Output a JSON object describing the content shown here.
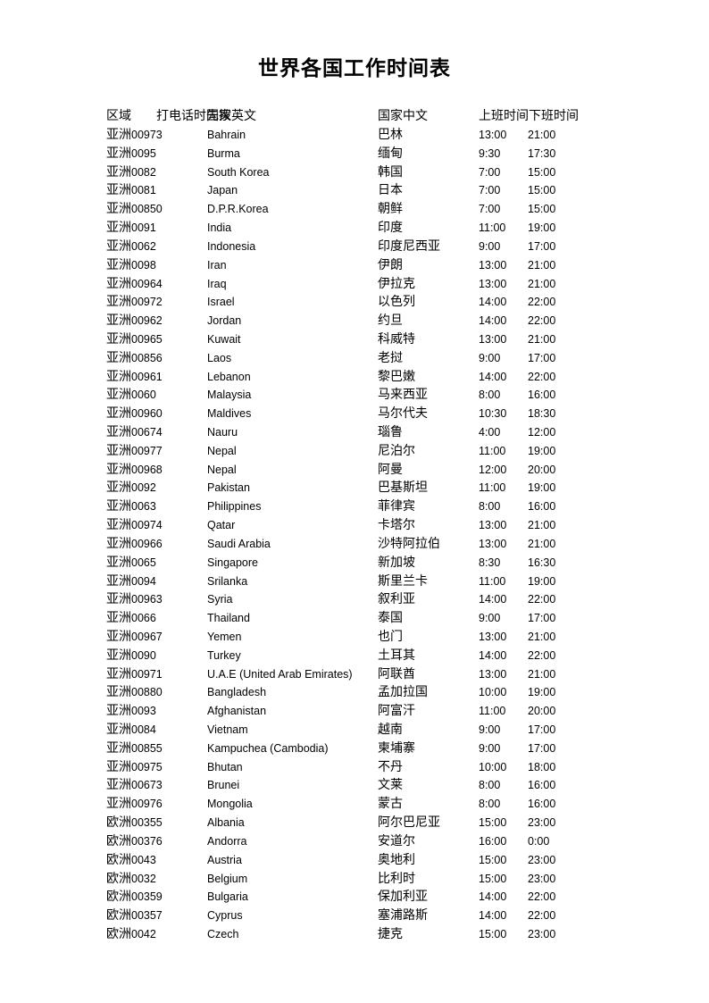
{
  "title": "世界各国工作时间表",
  "headers": {
    "region": "区域",
    "dial_prefix": "打电话时先拨",
    "country_en": "国家英文",
    "country_zh": "国家中文",
    "start_time": "上班时间",
    "end_time": "下班时间"
  },
  "rows": [
    {
      "region": "亚洲",
      "code": "00973",
      "en": "Bahrain",
      "zh": "巴林",
      "start": "13:00",
      "end": "21:00"
    },
    {
      "region": "亚洲",
      "code": "0095",
      "en": "Burma",
      "zh": "缅甸",
      "start": "9:30",
      "end": "17:30"
    },
    {
      "region": "亚洲",
      "code": "0082",
      "en": "South Korea",
      "zh": "韩国",
      "start": "7:00",
      "end": "15:00"
    },
    {
      "region": "亚洲",
      "code": "0081",
      "en": "Japan",
      "zh": "日本",
      "start": "7:00",
      "end": "15:00"
    },
    {
      "region": "亚洲",
      "code": "00850",
      "en": "D.P.R.Korea",
      "zh": "朝鲜",
      "start": "7:00",
      "end": "15:00"
    },
    {
      "region": "亚洲",
      "code": "0091",
      "en": "India",
      "zh": "印度",
      "start": "11:00",
      "end": "19:00"
    },
    {
      "region": "亚洲",
      "code": "0062",
      "en": "Indonesia",
      "zh": "印度尼西亚",
      "start": "9:00",
      "end": "17:00"
    },
    {
      "region": "亚洲",
      "code": "0098",
      "en": "Iran",
      "zh": "伊朗",
      "start": "13:00",
      "end": "21:00"
    },
    {
      "region": "亚洲",
      "code": "00964",
      "en": "Iraq",
      "zh": "伊拉克",
      "start": "13:00",
      "end": "21:00"
    },
    {
      "region": "亚洲",
      "code": "00972",
      "en": "Israel",
      "zh": "以色列",
      "start": "14:00",
      "end": "22:00"
    },
    {
      "region": "亚洲",
      "code": "00962",
      "en": "Jordan",
      "zh": "约旦",
      "start": "14:00",
      "end": "22:00"
    },
    {
      "region": "亚洲",
      "code": "00965",
      "en": "Kuwait",
      "zh": "科威特",
      "start": "13:00",
      "end": "21:00"
    },
    {
      "region": "亚洲",
      "code": "00856",
      "en": "Laos",
      "zh": "老挝",
      "start": "9:00",
      "end": "17:00"
    },
    {
      "region": "亚洲",
      "code": "00961",
      "en": "Lebanon",
      "zh": "黎巴嫩",
      "start": "14:00",
      "end": "22:00"
    },
    {
      "region": "亚洲",
      "code": "0060",
      "en": "Malaysia",
      "zh": "马来西亚",
      "start": "8:00",
      "end": "16:00"
    },
    {
      "region": "亚洲",
      "code": "00960",
      "en": "Maldives",
      "zh": "马尔代夫",
      "start": "10:30",
      "end": "18:30"
    },
    {
      "region": "亚洲",
      "code": "00674",
      "en": "Nauru",
      "zh": "瑙鲁",
      "start": "4:00",
      "end": "12:00"
    },
    {
      "region": "亚洲",
      "code": "00977",
      "en": "Nepal",
      "zh": "尼泊尔",
      "start": "11:00",
      "end": "19:00"
    },
    {
      "region": "亚洲",
      "code": "00968",
      "en": "Nepal",
      "zh": "阿曼",
      "start": "12:00",
      "end": "20:00"
    },
    {
      "region": "亚洲",
      "code": "0092",
      "en": "Pakistan",
      "zh": "巴基斯坦",
      "start": "11:00",
      "end": "19:00"
    },
    {
      "region": "亚洲",
      "code": "0063",
      "en": "Philippines",
      "zh": "菲律宾",
      "start": "8:00",
      "end": "16:00"
    },
    {
      "region": "亚洲",
      "code": "00974",
      "en": "Qatar",
      "zh": "卡塔尔",
      "start": "13:00",
      "end": "21:00"
    },
    {
      "region": "亚洲",
      "code": "00966",
      "en": "Saudi Arabia",
      "zh": "沙特阿拉伯",
      "start": "13:00",
      "end": "21:00"
    },
    {
      "region": "亚洲",
      "code": "0065",
      "en": "Singapore",
      "zh": "新加坡",
      "start": "8:30",
      "end": "16:30"
    },
    {
      "region": "亚洲",
      "code": "0094",
      "en": "Srilanka",
      "zh": "斯里兰卡",
      "start": "11:00",
      "end": "19:00"
    },
    {
      "region": "亚洲",
      "code": "00963",
      "en": "Syria",
      "zh": "叙利亚",
      "start": "14:00",
      "end": "22:00"
    },
    {
      "region": "亚洲",
      "code": "0066",
      "en": "Thailand",
      "zh": "泰国",
      "start": "9:00",
      "end": "17:00"
    },
    {
      "region": "亚洲",
      "code": "00967",
      "en": "Yemen",
      "zh": "也门",
      "start": "13:00",
      "end": "21:00"
    },
    {
      "region": "亚洲",
      "code": "0090",
      "en": "Turkey",
      "zh": "土耳其",
      "start": "14:00",
      "end": "22:00"
    },
    {
      "region": "亚洲",
      "code": "00971",
      "en": "U.A.E (United Arab Emirates)",
      "zh": "阿联酋",
      "start": "13:00",
      "end": "21:00"
    },
    {
      "region": "亚洲",
      "code": "00880",
      "en": "Bangladesh",
      "zh": "孟加拉国",
      "start": "10:00",
      "end": "19:00"
    },
    {
      "region": "亚洲",
      "code": "0093",
      "en": "Afghanistan",
      "zh": "阿富汗",
      "start": "11:00",
      "end": "20:00"
    },
    {
      "region": "亚洲",
      "code": "0084",
      "en": "Vietnam",
      "zh": "越南",
      "start": "9:00",
      "end": "17:00"
    },
    {
      "region": "亚洲",
      "code": "00855",
      "en": "Kampuchea (Cambodia)",
      "zh": "柬埔寨",
      "start": "9:00",
      "end": "17:00"
    },
    {
      "region": "亚洲",
      "code": "00975",
      "en": "Bhutan",
      "zh": "不丹",
      "start": "10:00",
      "end": "18:00"
    },
    {
      "region": "亚洲",
      "code": "00673",
      "en": "Brunei",
      "zh": "文莱",
      "start": "8:00",
      "end": "16:00"
    },
    {
      "region": "亚洲",
      "code": "00976",
      "en": "Mongolia",
      "zh": "蒙古",
      "start": "8:00",
      "end": "16:00"
    },
    {
      "region": "欧洲",
      "code": "00355",
      "en": "Albania",
      "zh": "阿尔巴尼亚",
      "start": "15:00",
      "end": "23:00"
    },
    {
      "region": "欧洲",
      "code": "00376",
      "en": "Andorra",
      "zh": "安道尔",
      "start": "16:00",
      "end": "0:00"
    },
    {
      "region": "欧洲",
      "code": "0043",
      "en": "Austria",
      "zh": "奥地利",
      "start": "15:00",
      "end": "23:00"
    },
    {
      "region": "欧洲",
      "code": "0032",
      "en": "Belgium",
      "zh": "比利时",
      "start": "15:00",
      "end": "23:00"
    },
    {
      "region": "欧洲",
      "code": "00359",
      "en": "Bulgaria",
      "zh": "保加利亚",
      "start": "14:00",
      "end": "22:00"
    },
    {
      "region": "欧洲",
      "code": "00357",
      "en": "Cyprus",
      "zh": "塞浦路斯",
      "start": "14:00",
      "end": "22:00"
    },
    {
      "region": "欧洲",
      "code": "0042",
      "en": "Czech",
      "zh": "捷克",
      "start": "15:00",
      "end": "23:00"
    }
  ]
}
